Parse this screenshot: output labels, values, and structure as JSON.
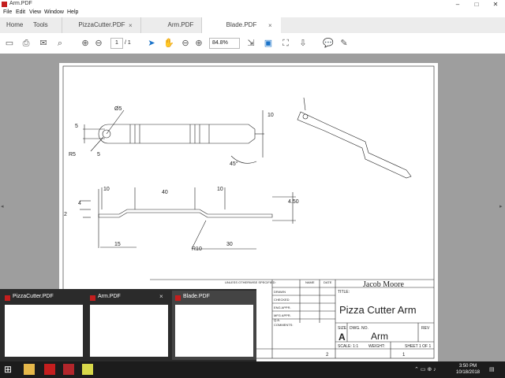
{
  "window": {
    "title": "Arm.PDF"
  },
  "menu": [
    "File",
    "Edit",
    "View",
    "Window",
    "Help"
  ],
  "tabs": {
    "home": "Home",
    "tools": "Tools",
    "docs": [
      {
        "label": "PizzaCutter.PDF",
        "close": "×"
      },
      {
        "label": "Arm.PDF",
        "close": "×"
      },
      {
        "label": "Blade.PDF",
        "close": "×"
      }
    ]
  },
  "toolbar": {
    "page_current": "1",
    "page_total": "/ 1",
    "zoom": "84.8%"
  },
  "drawing": {
    "dims": {
      "d5": "5",
      "dia5": "Ø5",
      "r5": "R5",
      "five_b": "5",
      "ten_r": "10",
      "angle": "45°",
      "t10a": "10",
      "t40": "40",
      "t10b": "10",
      "h4": "4",
      "h450": "4.50",
      "h2": "2",
      "b15": "15",
      "r10": "R10",
      "b30": "30"
    },
    "title_block": {
      "unless": "UNLESS OTHERWISE SPECIFIED:",
      "name": "NAME",
      "date": "DATE",
      "drawn": "DRAWN",
      "checked": "CHECKED",
      "eng_appr": "ENG APPR.",
      "mfg_appr": "MFG APPR.",
      "qa": "Q.A.",
      "comments": "COMMENTS:",
      "author": "Jacob Moore",
      "title_label": "TITLE:",
      "title": "Pizza Cutter Arm",
      "size_label": "SIZE",
      "size": "A",
      "dwg_no_label": "DWG.  NO.",
      "dwg_no": "Arm",
      "rev_label": "REV",
      "scale": "SCALE: 1:1",
      "weight": "WEIGHT:",
      "sheet": "SHEET 1 OF 1",
      "zone2": "2",
      "zone1": "1"
    }
  },
  "thumbnails": [
    {
      "label": "PizzaCutter.PDF",
      "close": ""
    },
    {
      "label": "Arm.PDF",
      "close": ""
    },
    {
      "label": "Blade.PDF",
      "close": "×"
    }
  ],
  "taskbar": {
    "time": "3:50 PM",
    "date": "10/18/2018"
  }
}
